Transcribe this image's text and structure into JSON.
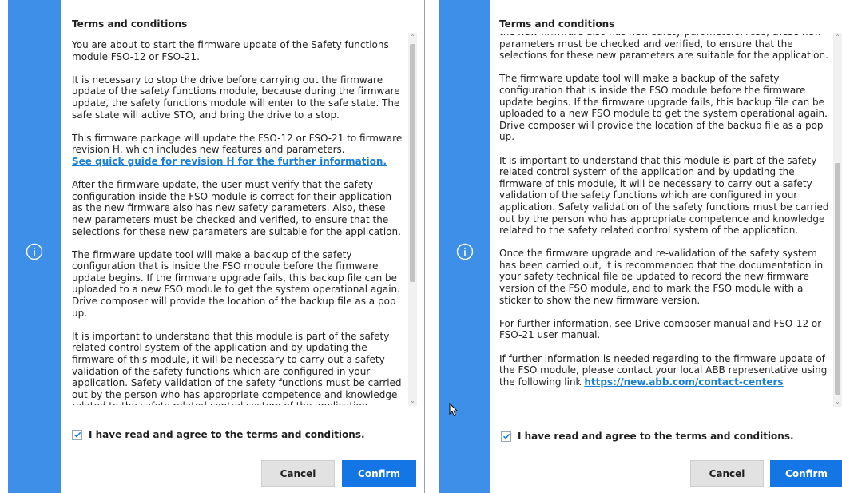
{
  "dialog_left": {
    "title": "Terms and conditions",
    "icon": "info-icon",
    "paragraphs": {
      "p1": "You are about to start the firmware update of the Safety functions module FSO-12 or FSO-21.",
      "p2": "It is necessary to stop the drive before carrying out the firmware update of the safety functions module, because during the firmware update, the safety functions module will enter to the safe state. The safe state will active STO, and bring the drive to a stop.",
      "p3": "This firmware package will update the FSO-12 or FSO-21 to firmware revision H, which includes new features and parameters.",
      "p3_link": "See quick guide for revision H for the further information.",
      "p4": "After the firmware update, the user must verify that the safety configuration inside the FSO module is correct for their application as the new firmware also has new safety parameters. Also, these new parameters must be checked and verified, to ensure that the selections for these new parameters are suitable for the application.",
      "p5": "The firmware update tool will make a backup of the safety configuration that is inside the FSO module before the firmware update begins. If the firmware upgrade fails, this backup file can be uploaded to a new FSO module to get the system operational again. Drive composer will provide the location of the backup file as a pop up.",
      "p6": "It is important to understand that this module is part of the safety related control system of the application and by updating the firmware of this module, it will be necessary to carry out a safety validation of the safety functions which are configured in your application. Safety validation of the safety functions must be carried out by the person who has appropriate competence and knowledge related to the safety related control system of the application."
    },
    "agree_label": "I have read and agree to the terms and conditions.",
    "agree_checked": true,
    "cancel_label": "Cancel",
    "confirm_label": "Confirm"
  },
  "dialog_right": {
    "title": "Terms and conditions",
    "icon": "info-icon",
    "paragraphs": {
      "p1_cont": "the new firmware also has new safety parameters. Also, these new parameters must be checked and verified, to ensure that the selections for these new parameters are suitable for the application.",
      "p2": "The firmware update tool will make a backup of the safety configuration that is inside the FSO module before the firmware update begins. If the firmware upgrade fails, this backup file can be uploaded to a new FSO module to get the system operational again. Drive composer will provide the location of the backup file as a pop up.",
      "p3": "It is important to understand that this module is part of the safety related control system of the application and by updating the firmware of this module, it will be necessary to carry out a safety validation of the safety functions which are configured in your application. Safety validation of the safety functions must be carried out by the person who has appropriate competence and knowledge related to the safety related control system of the application.",
      "p4": "Once the firmware upgrade and re-validation of the safety system has been carried out, it is recommended that the documentation in your safety technical file be updated to record the new firmware version of the FSO module, and to mark the FSO module with a sticker to show the new firmware version.",
      "p5": "For further information, see Drive composer manual and FSO-12 or FSO-21 user manual.",
      "p6": "If further information is needed regarding to the firmware update of the FSO module, please contact your local ABB representative using the following link",
      "p6_link": "https://new.abb.com/contact-centers"
    },
    "agree_label": "I have read and agree to the terms and conditions.",
    "agree_checked": true,
    "cancel_label": "Cancel",
    "confirm_label": "Confirm"
  },
  "colors": {
    "rail": "#3d8fe8",
    "confirm_bg": "#1476e4",
    "link": "#1a7fd4",
    "cancel_bg": "#e2e2e2"
  }
}
